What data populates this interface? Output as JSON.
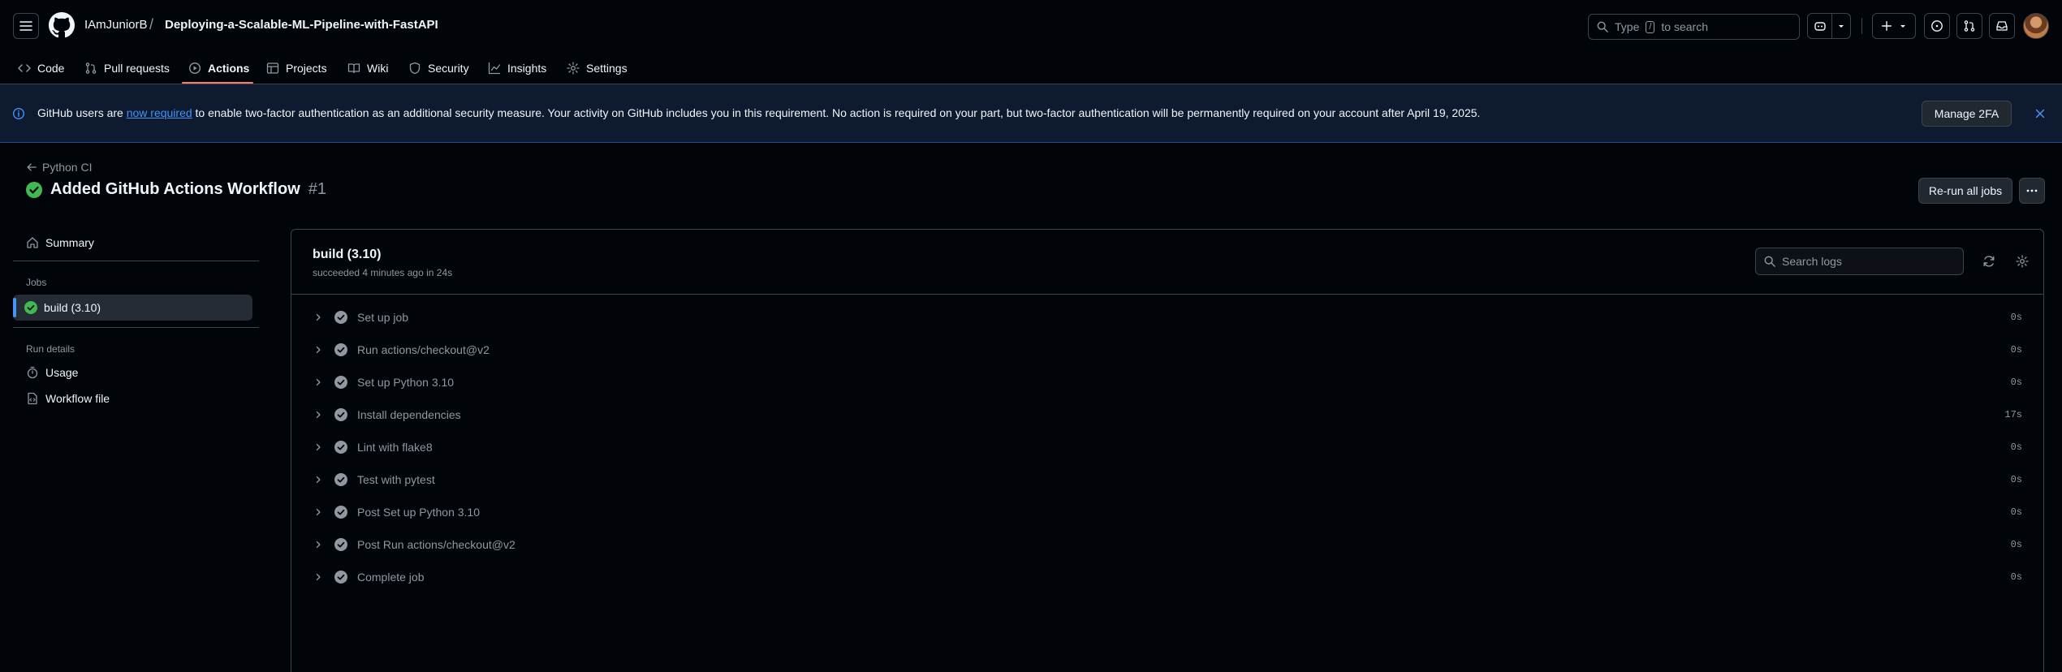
{
  "header": {
    "owner": "IAmJuniorB",
    "separator": "/",
    "repo": "Deploying-a-Scalable-ML-Pipeline-with-FastAPI",
    "search_prefix": "Type",
    "search_key": "/",
    "search_suffix": "to search"
  },
  "tabs": [
    {
      "label": "Code",
      "icon": "code-icon"
    },
    {
      "label": "Pull requests",
      "icon": "git-pull-request-icon"
    },
    {
      "label": "Actions",
      "icon": "play-icon",
      "selected": true
    },
    {
      "label": "Projects",
      "icon": "table-icon"
    },
    {
      "label": "Wiki",
      "icon": "book-icon"
    },
    {
      "label": "Security",
      "icon": "shield-icon"
    },
    {
      "label": "Insights",
      "icon": "graph-icon"
    },
    {
      "label": "Settings",
      "icon": "gear-icon"
    }
  ],
  "banner": {
    "text_before": "GitHub users are ",
    "link": "now required",
    "text_after": " to enable two-factor authentication as an additional security measure. Your activity on GitHub includes you in this requirement. No action is required on your part, but two-factor authentication will be permanently required on your account after April 19, 2025.",
    "button": "Manage 2FA"
  },
  "run": {
    "back": "Python CI",
    "title": "Added GitHub Actions Workflow",
    "number": "#1",
    "rerun": "Re-run all jobs"
  },
  "sidebar": {
    "summary": "Summary",
    "jobs_label": "Jobs",
    "job": "build (3.10)",
    "run_details_label": "Run details",
    "usage": "Usage",
    "workflow_file": "Workflow file"
  },
  "log": {
    "title": "build (3.10)",
    "subtitle": "succeeded 4 minutes ago in 24s",
    "search_placeholder": "Search logs",
    "steps": [
      {
        "name": "Set up job",
        "duration": "0s"
      },
      {
        "name": "Run actions/checkout@v2",
        "duration": "0s"
      },
      {
        "name": "Set up Python 3.10",
        "duration": "0s"
      },
      {
        "name": "Install dependencies",
        "duration": "17s"
      },
      {
        "name": "Lint with flake8",
        "duration": "0s"
      },
      {
        "name": "Test with pytest",
        "duration": "0s"
      },
      {
        "name": "Post Set up Python 3.10",
        "duration": "0s"
      },
      {
        "name": "Post Run actions/checkout@v2",
        "duration": "0s"
      },
      {
        "name": "Complete job",
        "duration": "0s"
      }
    ]
  },
  "colors": {
    "background": "#010409",
    "accent": "#4493f8",
    "success": "#3fb950",
    "tab_underline": "#f78166"
  }
}
